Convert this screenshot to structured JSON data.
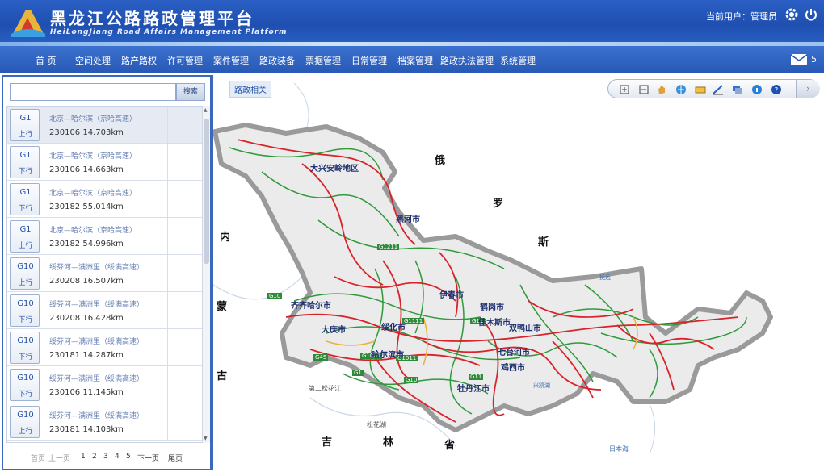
{
  "header": {
    "title_cn": "黑龙江公路路政管理平台",
    "title_en": "HeiLongJiang Road Affairs Management Platform",
    "user_label": "当前用户：管理员",
    "colors": {
      "header_bg": "#1f4fb0",
      "nav_bg": "#2758b5",
      "accent": "#3a68bf"
    }
  },
  "nav": {
    "items": [
      "首 页",
      "空间处理",
      "路产路权",
      "许可管理",
      "案件管理",
      "路政装备",
      "票据管理",
      "日常管理",
      "档案管理",
      "路政执法管理",
      "系统管理"
    ],
    "mail_count": "5"
  },
  "sidebar": {
    "search_placeholder": "",
    "search_button": "搜索",
    "rows": [
      {
        "code": "G1",
        "dir": "上行",
        "name": "北京—哈尔滨（京哈高速）",
        "stake": "230106  14.703km"
      },
      {
        "code": "G1",
        "dir": "下行",
        "name": "北京—哈尔滨（京哈高速）",
        "stake": "230106  14.663km"
      },
      {
        "code": "G1",
        "dir": "下行",
        "name": "北京—哈尔滨（京哈高速）",
        "stake": "230182  55.014km"
      },
      {
        "code": "G1",
        "dir": "上行",
        "name": "北京—哈尔滨（京哈高速）",
        "stake": "230182  54.996km"
      },
      {
        "code": "G10",
        "dir": "上行",
        "name": "绥芬河—满洲里（绥满高速）",
        "stake": "230208  16.507km"
      },
      {
        "code": "G10",
        "dir": "下行",
        "name": "绥芬河—满洲里（绥满高速）",
        "stake": "230208  16.428km"
      },
      {
        "code": "G10",
        "dir": "下行",
        "name": "绥芬河—满洲里（绥满高速）",
        "stake": "230181  14.287km"
      },
      {
        "code": "G10",
        "dir": "下行",
        "name": "绥芬河—满洲里（绥满高速）",
        "stake": "230106  11.145km"
      },
      {
        "code": "G10",
        "dir": "上行",
        "name": "绥芬河—满洲里（绥满高速）",
        "stake": "230181  14.103km"
      }
    ],
    "pager": {
      "first": "首页",
      "prev": "上一页",
      "pages": [
        "1",
        "2",
        "3",
        "4",
        "5"
      ],
      "next": "下一页",
      "last": "尾页"
    }
  },
  "map": {
    "tag": "路政相关",
    "toolbar_icons": [
      "zoom-in-icon",
      "zoom-out-icon",
      "pan-hand-icon",
      "globe-icon",
      "measure-icon",
      "draw-icon",
      "layers-icon",
      "info-icon",
      "help-icon"
    ],
    "cities": [
      {
        "name": "大兴安岭地区"
      },
      {
        "name": "黑河市"
      },
      {
        "name": "伊春市"
      },
      {
        "name": "鹤岗市"
      },
      {
        "name": "齐齐哈尔市"
      },
      {
        "name": "绥化市"
      },
      {
        "name": "大庆市"
      },
      {
        "name": "哈尔滨市"
      },
      {
        "name": "佳木斯市"
      },
      {
        "name": "双鸭山市"
      },
      {
        "name": "七台河市"
      },
      {
        "name": "鸡西市"
      },
      {
        "name": "牡丹江市"
      }
    ],
    "countries": [
      "俄",
      "罗",
      "斯",
      "内",
      "蒙",
      "古",
      "吉",
      "林",
      "省"
    ],
    "minor_labels": [
      "第二松花江",
      "松花湖",
      "日本海",
      "抚远",
      "兴凯湖"
    ],
    "road_shields": [
      "G1211",
      "G10",
      "G1111",
      "G11",
      "G45",
      "G1001",
      "G1011",
      "G1",
      "G10",
      "G11"
    ]
  }
}
